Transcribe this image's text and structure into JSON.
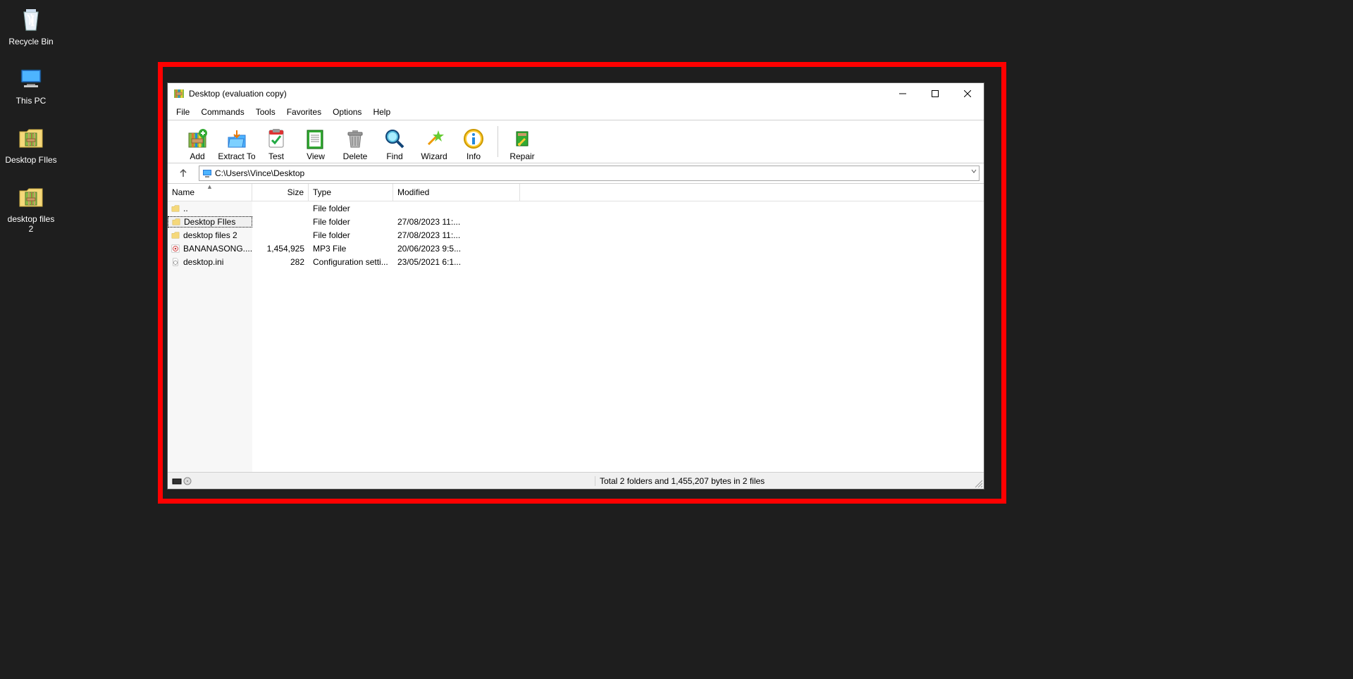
{
  "desktop_icons": [
    {
      "label": "Recycle Bin",
      "icon": "recycle"
    },
    {
      "label": "This PC",
      "icon": "pc"
    },
    {
      "label": "Desktop FIles",
      "icon": "archive"
    },
    {
      "label": "desktop files 2",
      "icon": "archive"
    }
  ],
  "window": {
    "title": "Desktop (evaluation copy)",
    "menubar": [
      "File",
      "Commands",
      "Tools",
      "Favorites",
      "Options",
      "Help"
    ],
    "toolbar": [
      {
        "label": "Add",
        "icon": "add"
      },
      {
        "label": "Extract To",
        "icon": "extract"
      },
      {
        "label": "Test",
        "icon": "test"
      },
      {
        "label": "View",
        "icon": "view"
      },
      {
        "label": "Delete",
        "icon": "delete"
      },
      {
        "label": "Find",
        "icon": "find"
      },
      {
        "label": "Wizard",
        "icon": "wizard"
      },
      {
        "label": "Info",
        "icon": "info"
      },
      {
        "sep": true
      },
      {
        "label": "Repair",
        "icon": "repair"
      }
    ],
    "address": "C:\\Users\\Vince\\Desktop",
    "columns": [
      "Name",
      "Size",
      "Type",
      "Modified"
    ],
    "rows": [
      {
        "name": "..",
        "size": "",
        "type": "File folder",
        "mod": "",
        "icon": "folder"
      },
      {
        "name": "Desktop FIles",
        "size": "",
        "type": "File folder",
        "mod": "27/08/2023 11:...",
        "icon": "folder",
        "selected": true
      },
      {
        "name": "desktop files 2",
        "size": "",
        "type": "File folder",
        "mod": "27/08/2023 11:...",
        "icon": "folder"
      },
      {
        "name": "BANANASONG....",
        "size": "1,454,925",
        "type": "MP3 File",
        "mod": "20/06/2023 9:5...",
        "icon": "mp3"
      },
      {
        "name": "desktop.ini",
        "size": "282",
        "type": "Configuration setti...",
        "mod": "23/05/2021 6:1...",
        "icon": "ini"
      }
    ],
    "status_right": "Total 2 folders and 1,455,207 bytes in 2 files"
  }
}
